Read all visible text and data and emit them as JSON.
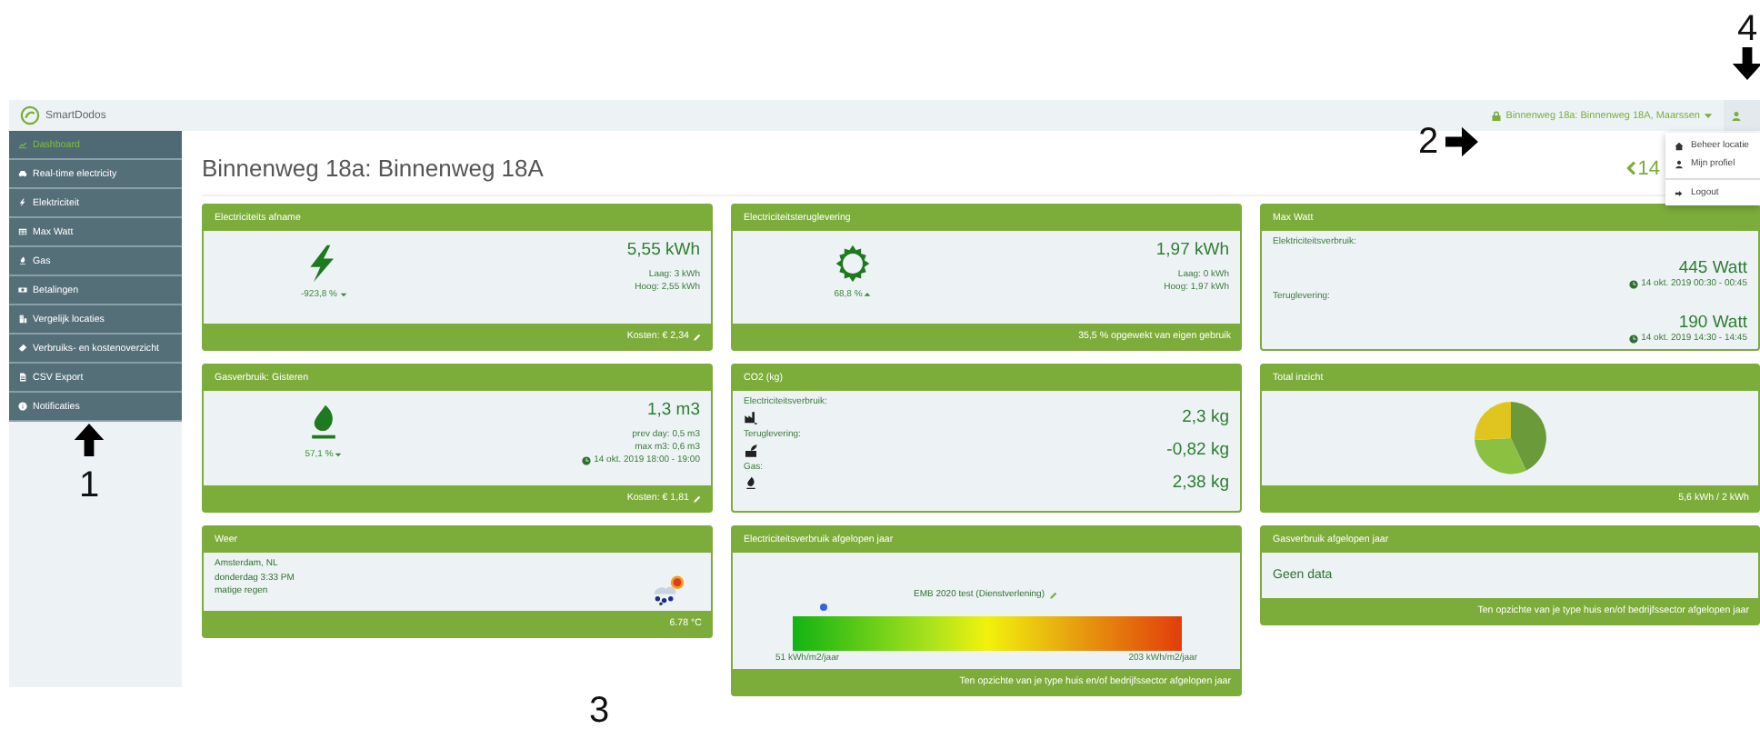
{
  "annotations": [
    {
      "label": "4"
    },
    {
      "label": "2"
    },
    {
      "label": "1"
    },
    {
      "label": "3"
    }
  ],
  "navbar": {
    "brand": "SmartDodos",
    "location_menu": "Binnenweg 18a: Binnenweg 18A, Maarssen"
  },
  "user_menu": {
    "expanded": true,
    "items": [
      {
        "label": "Beheer locatie",
        "divider_above": false
      },
      {
        "label": "Mijn profiel",
        "divider_above": false
      },
      {
        "label": "Logout",
        "divider_above": true
      }
    ]
  },
  "sidebar": {
    "items": [
      {
        "label": "Dashboard",
        "selected": true
      },
      {
        "label": "Real-time electricity",
        "selected": false
      },
      {
        "label": "Elektriciteit",
        "selected": false
      },
      {
        "label": "Max Watt",
        "selected": false
      },
      {
        "label": "Gas",
        "selected": false
      },
      {
        "label": "Betalingen",
        "selected": false
      },
      {
        "label": "Vergelijk locaties",
        "selected": false
      },
      {
        "label": "Verbruiks- en kostenoverzicht",
        "selected": false
      },
      {
        "label": "CSV Export",
        "selected": false
      },
      {
        "label": "Notificaties",
        "selected": false
      }
    ]
  },
  "page": {
    "title": "Binnenweg 18a: Binnenweg 18A",
    "date_nav": "14"
  },
  "cards": [
    {
      "kind": "meter",
      "title": "Electriciteits afname",
      "percent": "-923,8 %",
      "rising": false,
      "value": "5,55 kWh",
      "details": [
        "Laag: 3 kWh",
        "Hoog: 2,55 kWh"
      ],
      "footer": "Kosten: € 2,34",
      "footer_edit": true
    },
    {
      "kind": "meter",
      "title": "Electriciteitsteruglevering",
      "percent": "68,8 %",
      "rising": true,
      "value": "1,97 kWh",
      "details": [
        "Laag: 0 kWh",
        "Hoog: 1,97 kWh"
      ],
      "footer": "35,5 % opgewekt van eigen gebruik",
      "footer_edit": false
    },
    {
      "kind": "maxwatt",
      "title": "Max Watt",
      "sections": [
        {
          "label": "Elektriciteitsverbruik:",
          "value": "445 Watt",
          "time": "14 okt. 2019 00:30 - 00:45"
        },
        {
          "label": "Teruglevering:",
          "value": "190 Watt",
          "time": "14 okt. 2019 14:30 - 14:45"
        }
      ]
    },
    {
      "kind": "meter",
      "title": "Gasverbruik: Gisteren",
      "percent": "57,1 %",
      "rising": false,
      "value": "1,3 m3",
      "details": [
        "prev day: 0,5 m3",
        "max m3: 0,6 m3"
      ],
      "time": "14 okt. 2019 18:00 - 19:00",
      "footer": "Kosten: € 1,81",
      "footer_edit": true
    },
    {
      "kind": "co2",
      "title": "CO2 (kg)",
      "rows": [
        {
          "label": "Electriciteitsverbruik:",
          "value": "2,3 kg"
        },
        {
          "label": "Teruglevering:",
          "value": "-0,82 kg"
        },
        {
          "label": "Gas:",
          "value": "2,38 kg"
        }
      ]
    },
    {
      "kind": "pie",
      "title": "Total inzicht",
      "footer": "5,6 kWh / 2 kWh"
    },
    {
      "kind": "weather",
      "title": "Weer",
      "lines": [
        "Amsterdam, NL",
        "donderdag 3:33 PM",
        "matige regen"
      ],
      "footer": "6.78 °C"
    },
    {
      "kind": "label",
      "title": "Electriciteitsverbruik afgelopen jaar",
      "subtitle": "EMB 2020 test (Dienstverlening)",
      "level": 0.08,
      "min_label": "51 kWh/m2/jaar",
      "max_label": "203 kWh/m2/jaar",
      "footer": "Ten opzichte van je type huis en/of bedrijfssector afgelopen jaar"
    },
    {
      "kind": "nodata",
      "title": "Gasverbruik afgelopen jaar",
      "message": "Geen data",
      "footer": "Ten opzichte van je type huis en/of bedrijfssector afgelopen jaar"
    }
  ]
}
